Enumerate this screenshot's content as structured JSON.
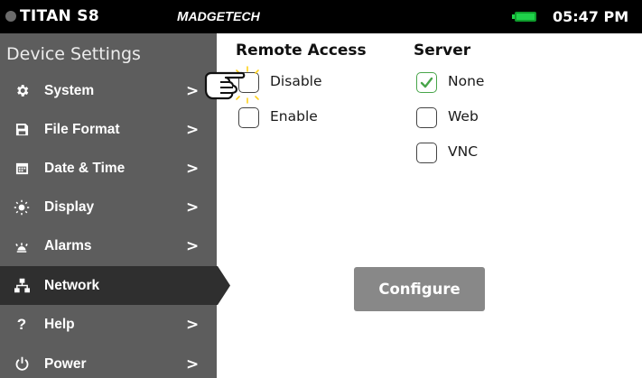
{
  "status_bar": {
    "model": "TITAN S8",
    "brand_first": "M",
    "brand_rest": "ADGE",
    "brand_second": "T",
    "brand_second_rest": "ECH",
    "time": "05:47 PM",
    "battery_color": "#1fd24a"
  },
  "sidebar": {
    "title": "Device Settings",
    "items": [
      {
        "label": "System",
        "icon": "gear-icon",
        "chevron": ">"
      },
      {
        "label": "File Format",
        "icon": "floppy-icon",
        "chevron": ">"
      },
      {
        "label": "Date & Time",
        "icon": "calendar-icon",
        "chevron": ">"
      },
      {
        "label": "Display",
        "icon": "sun-icon",
        "chevron": ">"
      },
      {
        "label": "Alarms",
        "icon": "alarm-icon",
        "chevron": ">"
      },
      {
        "label": "Network",
        "icon": "network-icon",
        "chevron": "",
        "active": true
      },
      {
        "label": "Help",
        "icon": "question-icon",
        "chevron": ">"
      },
      {
        "label": "Power",
        "icon": "power-icon",
        "chevron": ">"
      }
    ]
  },
  "remote_access": {
    "heading": "Remote Access",
    "options": [
      {
        "label": "Disable",
        "checked": false
      },
      {
        "label": "Enable",
        "checked": false
      }
    ]
  },
  "server": {
    "heading": "Server",
    "options": [
      {
        "label": "None",
        "checked": true
      },
      {
        "label": "Web",
        "checked": false
      },
      {
        "label": "VNC",
        "checked": false
      }
    ]
  },
  "configure_label": "Configure",
  "colors": {
    "sidebar_bg": "#5d5d5d",
    "active_bg": "#2f2f2f",
    "check_green": "#48a54a",
    "button_gray": "#888888"
  }
}
